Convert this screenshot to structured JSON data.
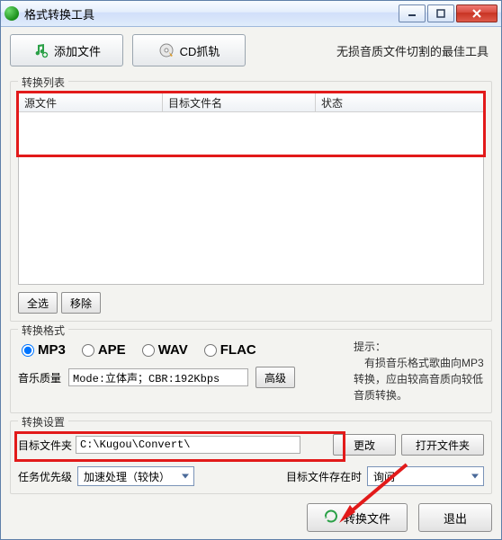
{
  "window": {
    "title": "格式转换工具"
  },
  "toolbar": {
    "add_file": "添加文件",
    "cd_grab": "CD抓轨"
  },
  "tagline": "无损音质文件切割的最佳工具",
  "list_group": {
    "legend": "转换列表",
    "columns": {
      "source": "源文件",
      "target": "目标文件名",
      "status": "状态"
    },
    "rows": [],
    "select_all": "全选",
    "remove": "移除"
  },
  "format_group": {
    "legend": "转换格式",
    "options": [
      "MP3",
      "APE",
      "WAV",
      "FLAC"
    ],
    "selected": "MP3",
    "hint_title": "提示：",
    "hint_body": "有损音乐格式歌曲向MP3转换，应由较高音质向较低音质转换。",
    "quality_label": "音乐质量",
    "quality_value": "Mode:立体声；CBR:192Kbps",
    "advanced": "高级"
  },
  "settings_group": {
    "legend": "转换设置",
    "dest_label": "目标文件夹",
    "dest_path": "C:\\Kugou\\Convert\\",
    "change": "更改",
    "open_folder": "打开文件夹",
    "priority_label": "任务优先级",
    "priority_value": "加速处理（较快）",
    "exists_label": "目标文件存在时",
    "exists_value": "询问"
  },
  "actions": {
    "convert": "转换文件",
    "exit": "退出"
  }
}
